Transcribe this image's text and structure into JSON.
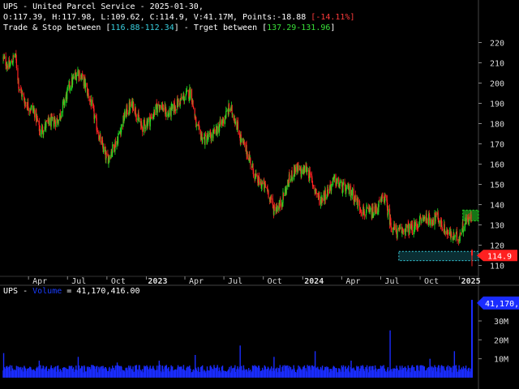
{
  "header": {
    "title": "UPS - United Parcel Service - 2025-01-30,",
    "ohlc": "O:117.39, H:117.98, L:109.62, C:114.9, V:41.17M, Points:-18.88 ",
    "change": "[-14.11%]",
    "trade_prefix": "Trade & Stop between [",
    "trade_range": "116.88-112.34",
    "target_prefix": "] - Trget between [",
    "target_range": "137.29-131.96",
    "target_suffix": "]"
  },
  "volume_header": {
    "symbol": "UPS - ",
    "label": "Volume",
    "value": " = 41,170,416.00"
  },
  "colors": {
    "up": "#22dd22",
    "down": "#ff2222",
    "volume": "#1a2cff",
    "target_zone": "#1a8a1a",
    "stop_zone": "#39d0e0",
    "price_badge": "#ff2020",
    "volume_badge": "#1a2cff"
  },
  "chart_data": [
    {
      "type": "candlestick",
      "series": [
        {
          "name": "UPS"
        }
      ],
      "x_start": "2022-02",
      "x_end": "2025-01-30",
      "x_ticks": [
        "Apr",
        "Jul",
        "Oct",
        "2023",
        "Apr",
        "Jul",
        "Oct",
        "2024",
        "Apr",
        "Jul",
        "Oct",
        "2025"
      ],
      "y_ticks": [
        110,
        120,
        130,
        140,
        150,
        160,
        170,
        180,
        190,
        200,
        210,
        220
      ],
      "ylim": [
        105,
        225
      ],
      "last_price_label": "114.9",
      "trend": [
        {
          "x": "2022-02-01",
          "y": 212
        },
        {
          "x": "2022-02-15",
          "y": 208
        },
        {
          "x": "2022-03-01",
          "y": 214
        },
        {
          "x": "2022-03-10",
          "y": 198
        },
        {
          "x": "2022-03-25",
          "y": 190
        },
        {
          "x": "2022-04-15",
          "y": 186
        },
        {
          "x": "2022-04-28",
          "y": 176
        },
        {
          "x": "2022-05-15",
          "y": 180
        },
        {
          "x": "2022-06-10",
          "y": 182
        },
        {
          "x": "2022-07-05",
          "y": 198
        },
        {
          "x": "2022-07-25",
          "y": 206
        },
        {
          "x": "2022-08-10",
          "y": 200
        },
        {
          "x": "2022-08-25",
          "y": 190
        },
        {
          "x": "2022-09-15",
          "y": 172
        },
        {
          "x": "2022-10-01",
          "y": 162
        },
        {
          "x": "2022-10-25",
          "y": 172
        },
        {
          "x": "2022-11-15",
          "y": 186
        },
        {
          "x": "2022-12-01",
          "y": 190
        },
        {
          "x": "2022-12-20",
          "y": 178
        },
        {
          "x": "2023-01-10",
          "y": 182
        },
        {
          "x": "2023-02-01",
          "y": 190
        },
        {
          "x": "2023-02-20",
          "y": 184
        },
        {
          "x": "2023-03-15",
          "y": 190
        },
        {
          "x": "2023-04-15",
          "y": 196
        },
        {
          "x": "2023-04-28",
          "y": 178
        },
        {
          "x": "2023-05-15",
          "y": 172
        },
        {
          "x": "2023-06-05",
          "y": 174
        },
        {
          "x": "2023-06-25",
          "y": 180
        },
        {
          "x": "2023-07-15",
          "y": 188
        },
        {
          "x": "2023-07-28",
          "y": 182
        },
        {
          "x": "2023-08-10",
          "y": 172
        },
        {
          "x": "2023-08-28",
          "y": 164
        },
        {
          "x": "2023-09-15",
          "y": 152
        },
        {
          "x": "2023-10-10",
          "y": 148
        },
        {
          "x": "2023-10-25",
          "y": 138
        },
        {
          "x": "2023-11-10",
          "y": 140
        },
        {
          "x": "2023-11-30",
          "y": 152
        },
        {
          "x": "2023-12-15",
          "y": 158
        },
        {
          "x": "2023-12-28",
          "y": 156
        },
        {
          "x": "2024-01-10",
          "y": 158
        },
        {
          "x": "2024-01-25",
          "y": 150
        },
        {
          "x": "2024-02-10",
          "y": 142
        },
        {
          "x": "2024-02-25",
          "y": 146
        },
        {
          "x": "2024-03-15",
          "y": 152
        },
        {
          "x": "2024-04-05",
          "y": 148
        },
        {
          "x": "2024-04-25",
          "y": 146
        },
        {
          "x": "2024-05-10",
          "y": 140
        },
        {
          "x": "2024-05-25",
          "y": 136
        },
        {
          "x": "2024-06-15",
          "y": 136
        },
        {
          "x": "2024-07-10",
          "y": 144
        },
        {
          "x": "2024-07-25",
          "y": 130
        },
        {
          "x": "2024-08-10",
          "y": 126
        },
        {
          "x": "2024-08-25",
          "y": 128
        },
        {
          "x": "2024-09-15",
          "y": 128
        },
        {
          "x": "2024-10-01",
          "y": 132
        },
        {
          "x": "2024-10-15",
          "y": 134
        },
        {
          "x": "2024-10-25",
          "y": 132
        },
        {
          "x": "2024-11-10",
          "y": 134
        },
        {
          "x": "2024-11-25",
          "y": 128
        },
        {
          "x": "2024-12-15",
          "y": 124
        },
        {
          "x": "2024-12-30",
          "y": 124
        },
        {
          "x": "2025-01-10",
          "y": 130
        },
        {
          "x": "2025-01-20",
          "y": 133
        },
        {
          "x": "2025-01-28",
          "y": 133
        },
        {
          "x": "2025-01-30",
          "y": 114.9
        }
      ],
      "target_zone": [
        131.96,
        137.29
      ],
      "stop_zone": [
        112.34,
        116.88
      ]
    },
    {
      "type": "bar",
      "series": [
        {
          "name": "Volume"
        }
      ],
      "y_ticks": [
        "10M",
        "20M",
        "30M"
      ],
      "ylim": [
        0,
        42000000
      ],
      "last_volume_label": "41,170,416.00",
      "last_volume": 41170416,
      "base_volume": 4500000,
      "spikes": [
        {
          "x": "2022-02-02",
          "v": 13000000
        },
        {
          "x": "2022-04-26",
          "v": 9000000
        },
        {
          "x": "2022-07-26",
          "v": 11000000
        },
        {
          "x": "2022-10-25",
          "v": 8000000
        },
        {
          "x": "2023-01-31",
          "v": 9000000
        },
        {
          "x": "2023-04-25",
          "v": 12000000
        },
        {
          "x": "2023-08-08",
          "v": 17000000
        },
        {
          "x": "2023-10-26",
          "v": 11000000
        },
        {
          "x": "2024-01-30",
          "v": 14000000
        },
        {
          "x": "2024-04-23",
          "v": 9000000
        },
        {
          "x": "2024-07-23",
          "v": 25000000
        },
        {
          "x": "2024-10-24",
          "v": 10000000
        },
        {
          "x": "2024-12-20",
          "v": 14000000
        }
      ]
    }
  ]
}
